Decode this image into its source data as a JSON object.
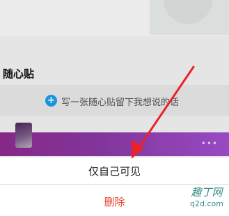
{
  "background_page": {
    "section_title": "随心贴",
    "compose_placeholder": "写一张随心贴留下我想说的话",
    "compose_icon": "plus-circle-icon",
    "note_more_icon": "more-dots-icon",
    "note_more_glyph": "•••"
  },
  "action_sheet": {
    "private_label": "仅自己可见",
    "delete_label": "删除"
  },
  "annotation": {
    "arrow_color": "#e8232b"
  },
  "watermark": {
    "brand": "趣丁网",
    "url": "q2d.com"
  },
  "colors": {
    "accent_blue": "#1a9ef0",
    "delete_red": "#e8452d",
    "note_purple": "#8b3aa6"
  }
}
